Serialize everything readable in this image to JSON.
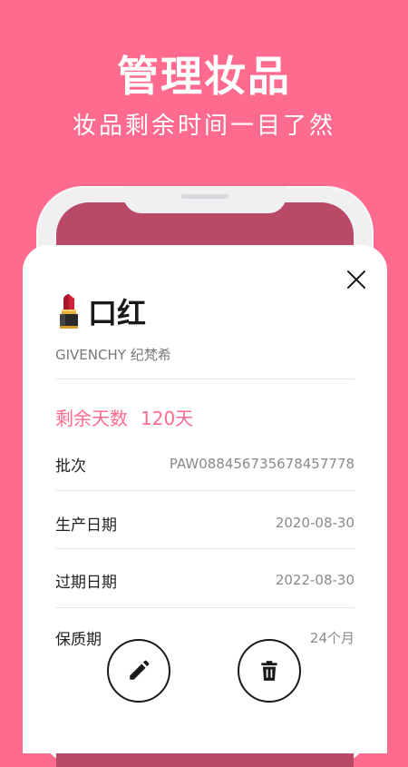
{
  "hero": {
    "title": "管理妆品",
    "subtitle": "妆品剩余时间一目了然"
  },
  "card": {
    "title": "口红",
    "title_icon": "lipstick-icon",
    "brand": "GIVENCHY 纪梵希",
    "remaining_label": "剩余天数",
    "remaining_value": "120天",
    "fields": [
      {
        "label": "批次",
        "value": "PAW088456735678457778"
      },
      {
        "label": "生产日期",
        "value": "2020-08-30"
      },
      {
        "label": "过期日期",
        "value": "2022-08-30"
      },
      {
        "label": "保质期",
        "value": "24个月"
      }
    ],
    "actions": {
      "edit_icon": "pencil-icon",
      "delete_icon": "trash-icon",
      "close_icon": "close-icon"
    }
  },
  "colors": {
    "brand_pink": "#ff6b8f",
    "card_bg": "#ffffff"
  }
}
